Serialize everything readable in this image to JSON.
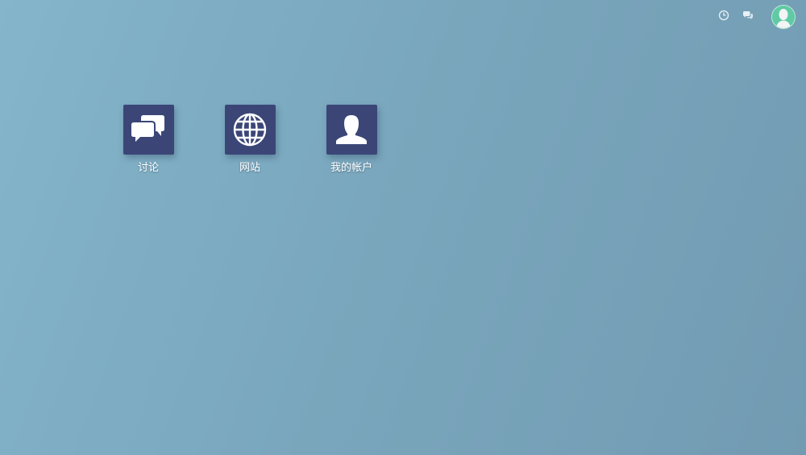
{
  "top_bar": {
    "icons": [
      "clock-icon",
      "chat-bubbles-icon"
    ],
    "avatar_color": "#5fcaa4"
  },
  "desktop": {
    "background_colors": [
      "#84b5cb",
      "#729bb2"
    ],
    "tile_color": "#3b4677",
    "apps": [
      {
        "label": "讨论",
        "icon": "chat-bubbles-icon"
      },
      {
        "label": "网站",
        "icon": "globe-icon"
      },
      {
        "label": "我的帐户",
        "icon": "user-icon"
      }
    ]
  }
}
